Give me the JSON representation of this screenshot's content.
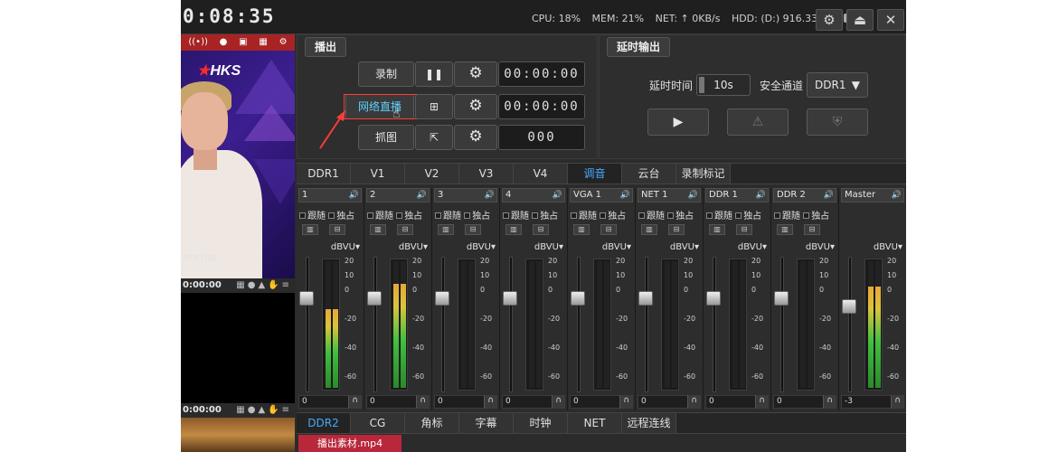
{
  "topbar": {
    "clock": "0:08:35",
    "cpu": "CPU: 18%",
    "mem": "MEM: 21%",
    "net": "NET: ↑ 0KB/s",
    "hdd": "HDD: (D:) 916.33GB",
    "icons": [
      "gear-icon",
      "eject-icon",
      "close-icon"
    ]
  },
  "preview": {
    "logo_prefix": "★",
    "logo_text": "HKS",
    "watermark": "onchip",
    "timecode1": "0:00:00",
    "timecode2": "0:00:00"
  },
  "broadcast": {
    "title": "播出",
    "rows": [
      {
        "label": "录制",
        "icon": "pause-icon",
        "time": "00:00:00"
      },
      {
        "label": "网络直播",
        "icon": "network-icon",
        "time": "00:00:00"
      },
      {
        "label": "抓图",
        "icon": "export-icon",
        "time": "000"
      }
    ]
  },
  "delay": {
    "title": "延时输出",
    "delay_label": "延时时间",
    "delay_value": "10s",
    "channel_label": "安全通道",
    "channel_value": "DDR1"
  },
  "tabs": {
    "top": [
      "DDR1",
      "V1",
      "V2",
      "V3",
      "V4",
      "调音",
      "云台",
      "录制标记"
    ],
    "top_active": "调音",
    "bottom": [
      "DDR2",
      "CG",
      "角标",
      "字幕",
      "时钟",
      "NET",
      "远程连线"
    ],
    "bottom_active": "DDR2"
  },
  "mixer": {
    "follow_label": "跟随",
    "solo_label": "独占",
    "unit": "dBVU",
    "scale": [
      "20",
      "10",
      "0",
      "-20",
      "-40",
      "-60"
    ],
    "channels": [
      {
        "name": "1",
        "value": "0",
        "fader": 0.72,
        "levels": [
          0.62,
          0.62
        ]
      },
      {
        "name": "2",
        "value": "0",
        "fader": 0.72,
        "levels": [
          0.82,
          0.82
        ]
      },
      {
        "name": "3",
        "value": "0",
        "fader": 0.72,
        "levels": [
          0,
          0
        ]
      },
      {
        "name": "4",
        "value": "0",
        "fader": 0.72,
        "levels": [
          0,
          0
        ]
      },
      {
        "name": "VGA 1",
        "value": "0",
        "fader": 0.72,
        "levels": [
          0,
          0
        ]
      },
      {
        "name": "NET 1",
        "value": "0",
        "fader": 0.72,
        "levels": [
          0,
          0
        ]
      },
      {
        "name": "DDR 1",
        "value": "0",
        "fader": 0.72,
        "levels": [
          0,
          0
        ]
      },
      {
        "name": "DDR 2",
        "value": "0",
        "fader": 0.72,
        "levels": [
          0,
          0
        ]
      },
      {
        "name": "Master",
        "value": "-3",
        "fader": 0.65,
        "levels": [
          0.8,
          0.8
        ]
      }
    ]
  },
  "file_tab": "播出素材.mp4"
}
